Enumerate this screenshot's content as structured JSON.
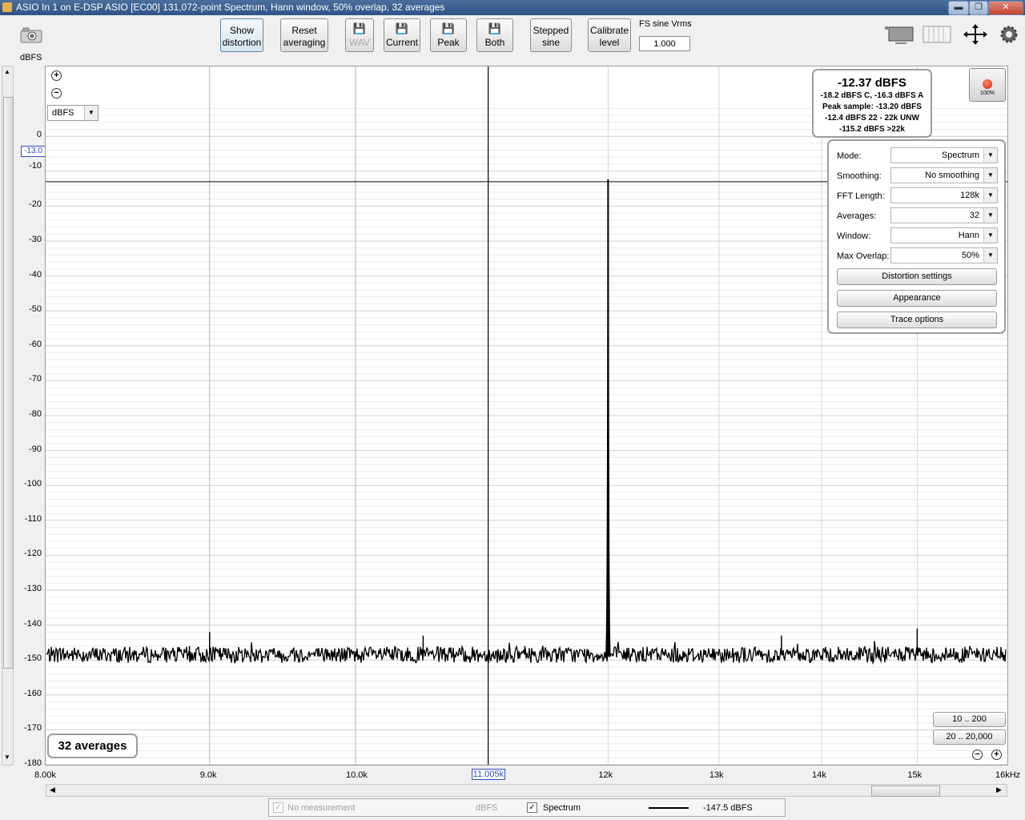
{
  "window": {
    "title": "ASIO In 1 on E-DSP ASIO [EC00] 131,072-point Spectrum, Hann window, 50% overlap, 32 averages",
    "min_symbol": "▬",
    "max_symbol": "❐",
    "close_symbol": "✕"
  },
  "toolbar": {
    "show_distortion": [
      "Show",
      "distortion"
    ],
    "reset_averaging": [
      "Reset",
      "averaging"
    ],
    "wav": "WAV",
    "current": "Current",
    "peak": "Peak",
    "both": "Both",
    "stepped_sine": [
      "Stepped",
      "sine"
    ],
    "calibrate_level": [
      "Calibrate",
      "level"
    ],
    "fs_sine_label": "FS sine Vrms",
    "fs_sine_value": "1.000"
  },
  "plot": {
    "y_unit_label": "dBFS",
    "units_select": "dBFS",
    "cursor_y_readout": "-13.0",
    "cursor_x_readout": "11.005k",
    "x_unit_label": "kHz"
  },
  "level_readout": {
    "main": "-12.37 dBFS",
    "lines": [
      "-18.2 dBFS C, -16.3 dBFS A",
      "Peak sample: -13.20 dBFS",
      "-12.4 dBFS 22 - 22k UNW",
      "-115.2 dBFS >22k"
    ]
  },
  "record_indicator": {
    "percent": "100%"
  },
  "settings": {
    "rows": [
      {
        "label": "Mode:",
        "value": "Spectrum"
      },
      {
        "label": "Smoothing:",
        "value": "No  smoothing"
      },
      {
        "label": "FFT Length:",
        "value": "128k"
      },
      {
        "label": "Averages:",
        "value": "32"
      },
      {
        "label": "Window:",
        "value": "Hann"
      },
      {
        "label": "Max Overlap:",
        "value": "50%"
      }
    ],
    "buttons": [
      "Distortion settings",
      "Appearance",
      "Trace options"
    ]
  },
  "averages_badge": "32 averages",
  "range_buttons": [
    "10 .. 200",
    "20 .. 20,000"
  ],
  "legend": {
    "no_measurement": "No measurement",
    "no_measurement_unit": "dBFS",
    "spectrum_label": "Spectrum",
    "spectrum_value": "-147.5 dBFS"
  },
  "chart_data": {
    "type": "line",
    "title": "",
    "xlabel": "kHz",
    "ylabel": "dBFS",
    "xlim": [
      8000,
      16000
    ],
    "ylim": [
      -180,
      10
    ],
    "x_scale": "log",
    "grid": true,
    "x_tick_labels": [
      "8.00k",
      "9.0k",
      "10.0k",
      "11.005k",
      "12k",
      "13k",
      "14k",
      "15k",
      "16kHz"
    ],
    "y_ticks": [
      0,
      -10,
      -20,
      -30,
      -40,
      -50,
      -60,
      -70,
      -80,
      -90,
      -100,
      -110,
      -120,
      -130,
      -140,
      -150,
      -160,
      -170,
      -180
    ],
    "series": [
      {
        "name": "Spectrum",
        "noise_floor": -148.5,
        "peaks": [
          {
            "x": 8870,
            "y": -146
          },
          {
            "x": 9000,
            "y": -142
          },
          {
            "x": 10500,
            "y": -143
          },
          {
            "x": 11300,
            "y": -146
          },
          {
            "x": 12000,
            "y": -12.4
          },
          {
            "x": 13600,
            "y": -143
          },
          {
            "x": 15000,
            "y": -141
          }
        ]
      }
    ],
    "cursor": {
      "x": 11005,
      "y": -13.0
    }
  }
}
